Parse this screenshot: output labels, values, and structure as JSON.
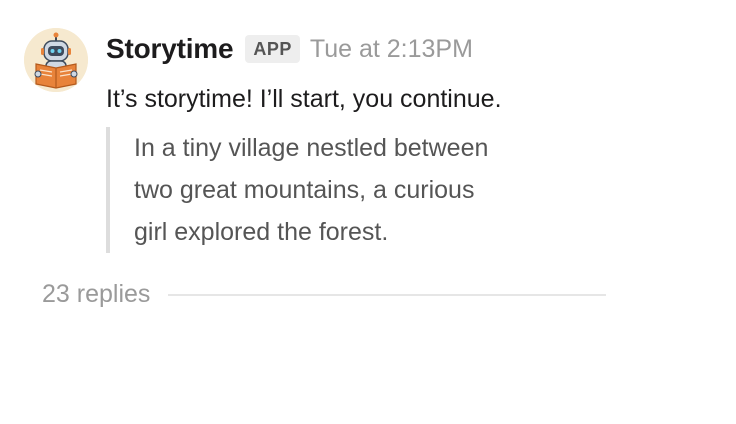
{
  "message": {
    "sender": "Storytime",
    "badge": "APP",
    "timestamp": "Tue at 2:13PM",
    "text": "It’s storytime! I’ll start, you continue.",
    "quote_lines": [
      "In a tiny village nestled between",
      "two great mountains, a curious",
      "girl explored the forest."
    ],
    "avatar_icon": "robot-reading-book-icon"
  },
  "thread": {
    "replies_label": "23 replies"
  },
  "colors": {
    "sender": "#1d1c1d",
    "muted": "#9a9a9a",
    "quote_bar": "#dddddd",
    "avatar_bg": "#f6e9cf",
    "book": "#e8833a"
  }
}
